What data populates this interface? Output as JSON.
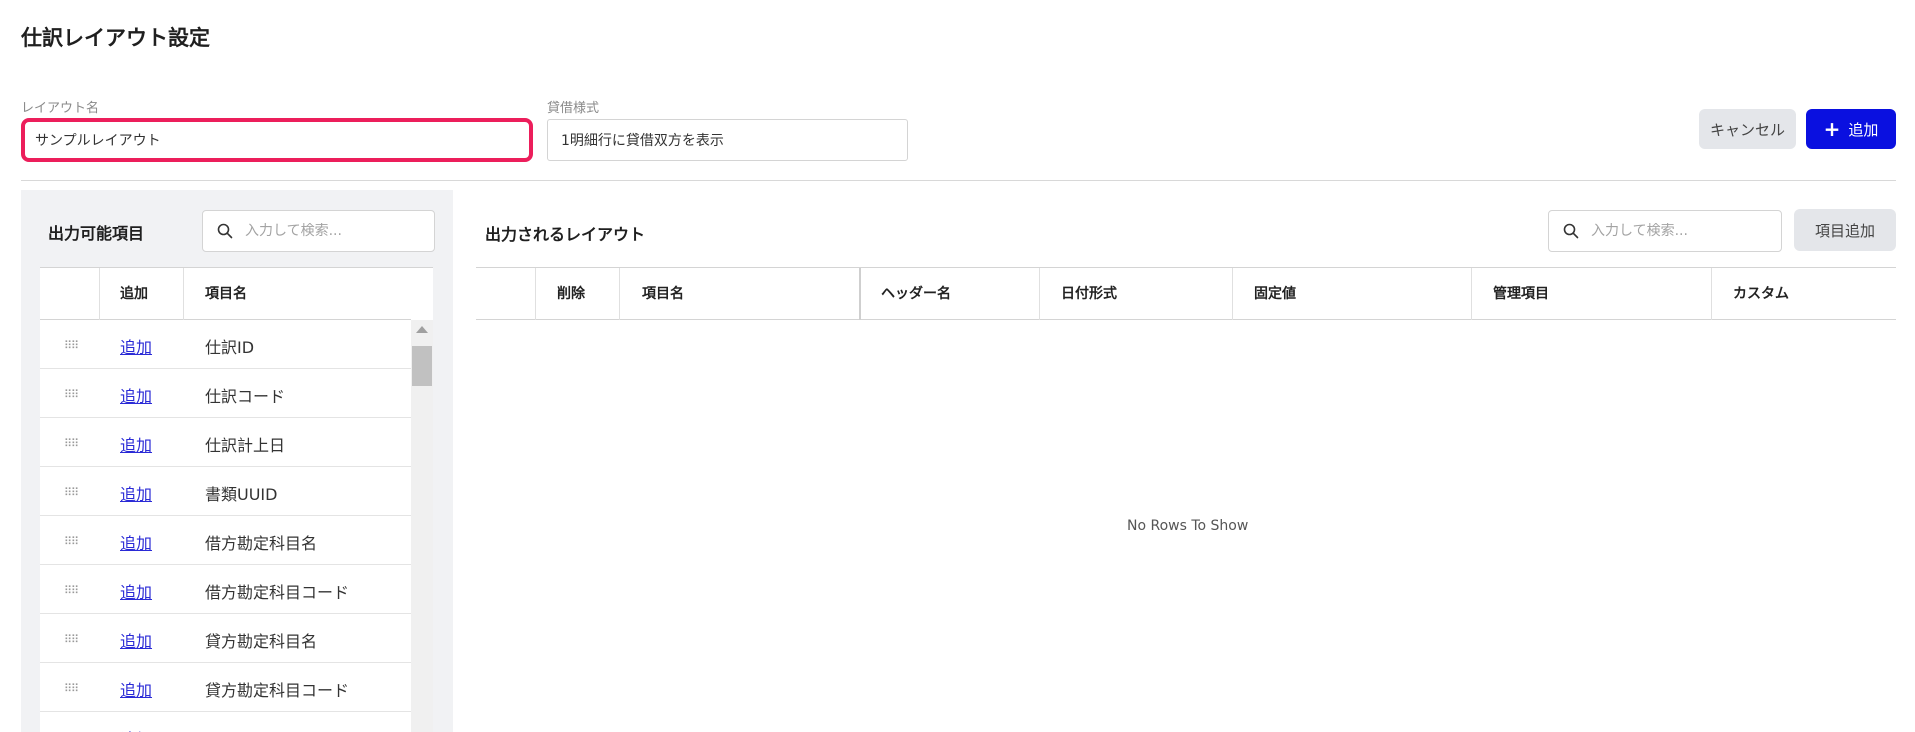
{
  "page": {
    "title": "仕訳レイアウト設定"
  },
  "form": {
    "layout_name_label": "レイアウト名",
    "layout_name_value": "サンプルレイアウト",
    "debit_credit_label": "貸借様式",
    "debit_credit_value": "1明細行に貸借双方を表示"
  },
  "actions": {
    "cancel_label": "キャンセル",
    "add_label": "追加",
    "item_add_label": "項目追加"
  },
  "left_panel": {
    "title": "出力可能項目",
    "search_placeholder": "入力して検索...",
    "columns": {
      "add": "追加",
      "name": "項目名"
    },
    "rows": [
      {
        "add": "追加",
        "name": "仕訳ID"
      },
      {
        "add": "追加",
        "name": "仕訳コード"
      },
      {
        "add": "追加",
        "name": "仕訳計上日"
      },
      {
        "add": "追加",
        "name": "書類UUID"
      },
      {
        "add": "追加",
        "name": "借方勘定科目名"
      },
      {
        "add": "追加",
        "name": "借方勘定科目コード"
      },
      {
        "add": "追加",
        "name": "貸方勘定科目名"
      },
      {
        "add": "追加",
        "name": "貸方勘定科目コード"
      },
      {
        "add": "追加",
        "name": ""
      }
    ]
  },
  "right_panel": {
    "title": "出力されるレイアウト",
    "search_placeholder": "入力して検索...",
    "columns": {
      "delete": "削除",
      "item_name": "項目名",
      "header_name": "ヘッダー名",
      "date_format": "日付形式",
      "fixed_value": "固定値",
      "managed_item": "管理項目",
      "custom": "カスタム"
    },
    "empty_message": "No Rows To Show"
  },
  "icons": {
    "search": "search-icon",
    "drag": "drag-handle-icon",
    "plus": "plus-icon"
  },
  "colors": {
    "accent": "#0a10e0",
    "focus": "#ec1e5b",
    "link": "#2a2ad6"
  }
}
